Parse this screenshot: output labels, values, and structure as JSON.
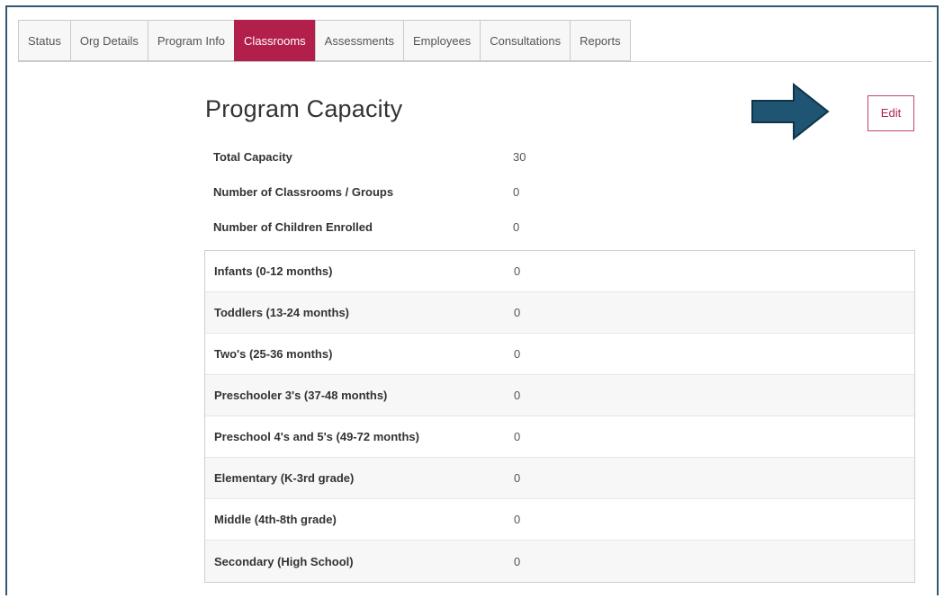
{
  "tabs": [
    {
      "label": "Status",
      "active": false
    },
    {
      "label": "Org Details",
      "active": false
    },
    {
      "label": "Program Info",
      "active": false
    },
    {
      "label": "Classrooms",
      "active": true
    },
    {
      "label": "Assessments",
      "active": false
    },
    {
      "label": "Employees",
      "active": false
    },
    {
      "label": "Consultations",
      "active": false
    },
    {
      "label": "Reports",
      "active": false
    }
  ],
  "page": {
    "title": "Program Capacity",
    "edit_label": "Edit"
  },
  "summary": [
    {
      "label": "Total Capacity",
      "value": "30"
    },
    {
      "label": "Number of Classrooms / Groups",
      "value": "0"
    },
    {
      "label": "Number of Children Enrolled",
      "value": "0"
    }
  ],
  "breakdown": [
    {
      "label": "Infants (0-12 months)",
      "value": "0"
    },
    {
      "label": "Toddlers (13-24 months)",
      "value": "0"
    },
    {
      "label": "Two's (25-36 months)",
      "value": "0"
    },
    {
      "label": "Preschooler 3's (37-48 months)",
      "value": "0"
    },
    {
      "label": "Preschool 4's and 5's (49-72 months)",
      "value": "0"
    },
    {
      "label": "Elementary (K-3rd grade)",
      "value": "0"
    },
    {
      "label": "Middle (4th-8th grade)",
      "value": "0"
    },
    {
      "label": "Secondary (High School)",
      "value": "0"
    }
  ],
  "colors": {
    "accent": "#b21f4a",
    "frame": "#2f5a73",
    "arrow": "#1f5573"
  },
  "icons": {
    "annotation_arrow": "arrow-right-icon"
  }
}
